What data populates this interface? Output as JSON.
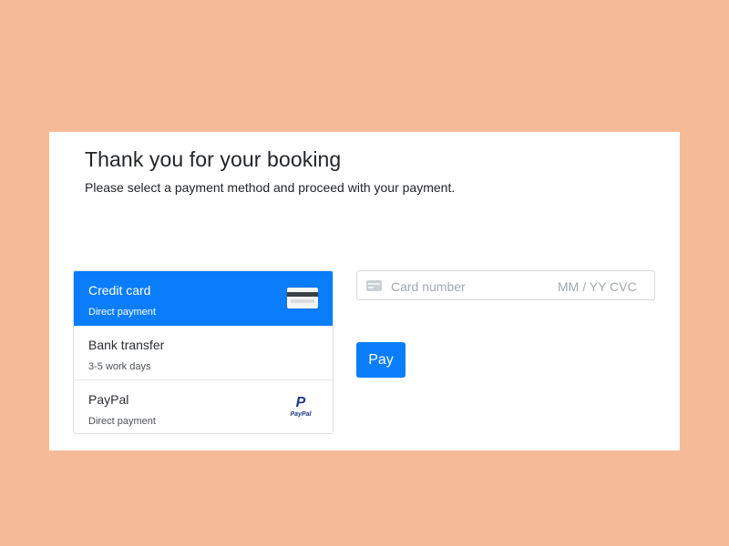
{
  "header": {
    "title": "Thank you for your booking",
    "subtitle": "Please select a payment method and proceed with your payment."
  },
  "payment_methods": [
    {
      "name": "Credit card",
      "description": "Direct payment",
      "icon": "credit-card-icon",
      "selected": true
    },
    {
      "name": "Bank transfer",
      "description": "3-5 work days",
      "icon": null,
      "selected": false
    },
    {
      "name": "PayPal",
      "description": "Direct payment",
      "icon": "paypal-logo-icon",
      "selected": false
    }
  ],
  "paypal_logo_text": "PayPal",
  "card_input": {
    "number_placeholder": "Card number",
    "expiry_placeholder": "MM / YY",
    "cvc_placeholder": "CVC",
    "icon": "card-chip-icon"
  },
  "pay_button_label": "Pay",
  "colors": {
    "background": "#f5bb98",
    "accent": "#0a7dfb",
    "panel": "#ffffff"
  }
}
